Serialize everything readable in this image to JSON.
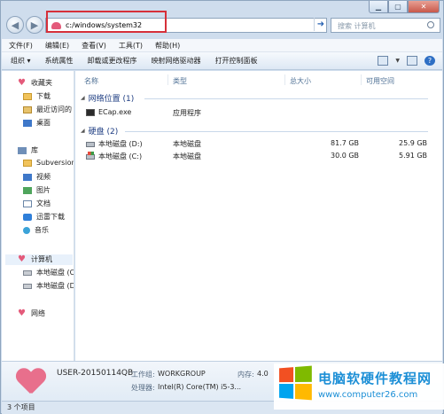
{
  "address": {
    "path": "c:/windows/system32",
    "search_placeholder": "搜索 计算机"
  },
  "menu": [
    "文件(F)",
    "编辑(E)",
    "查看(V)",
    "工具(T)",
    "帮助(H)"
  ],
  "toolbar": {
    "items": [
      "组织 ▾",
      "系统属性",
      "卸载或更改程序",
      "映射网络驱动器",
      "打开控制面板"
    ]
  },
  "nav": {
    "favorites": {
      "label": "收藏夹",
      "items": [
        "下载",
        "最近访问的",
        "桌面"
      ]
    },
    "libraries": {
      "label": "库",
      "items": [
        "Subversion",
        "视频",
        "图片",
        "文档",
        "迅雷下载",
        "音乐"
      ]
    },
    "computer": {
      "label": "计算机",
      "items": [
        "本地磁盘 (C",
        "本地磁盘 (D"
      ]
    },
    "network": {
      "label": "网络"
    }
  },
  "columns": [
    "名称",
    "类型",
    "总大小",
    "可用空间"
  ],
  "groups": {
    "network": {
      "label": "网络位置 (1)",
      "items": [
        {
          "name": "ECap.exe",
          "type": "应用程序",
          "total": "",
          "free": ""
        }
      ]
    },
    "disks": {
      "label": "硬盘 (2)",
      "items": [
        {
          "name": "本地磁盘 (D:)",
          "type": "本地磁盘",
          "total": "81.7 GB",
          "free": "25.9 GB"
        },
        {
          "name": "本地磁盘 (C:)",
          "type": "本地磁盘",
          "total": "30.0 GB",
          "free": "5.91 GB"
        }
      ]
    }
  },
  "details": {
    "computer_name": "USER-20150114QB",
    "workgroup_label": "工作组:",
    "workgroup": "WORKGROUP",
    "memory_label": "内存:",
    "memory": "4.0",
    "processor_label": "处理器:",
    "processor": "Intel(R) Core(TM) i5-3..."
  },
  "status": {
    "text": "3 个项目"
  },
  "watermark": {
    "title": "电脑软硬件教程网",
    "url": "www.computer26.com"
  },
  "colors": {
    "accent": "#1c8fd6",
    "highlight": "#d6303a",
    "group_header": "#1e3d82"
  }
}
